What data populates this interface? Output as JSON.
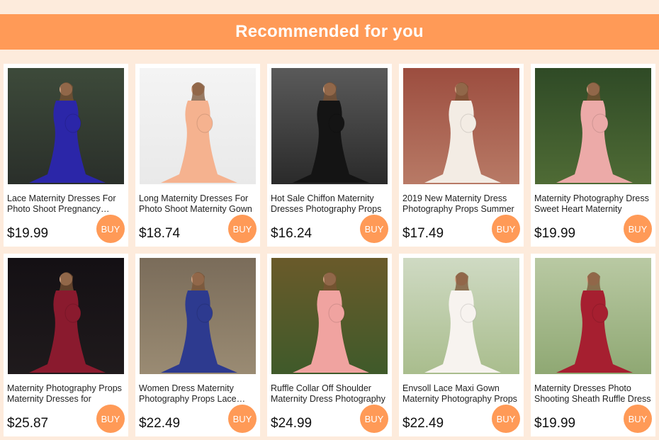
{
  "header": {
    "title": "Recommended for you"
  },
  "products": [
    {
      "title": "Lace Maternity Dresses For Photo Shoot Pregnancy Dress",
      "price": "$19.99",
      "buy_label": "BUY",
      "dress_color": "#2b26a8",
      "bg_top": "#3d4a3a",
      "bg_bottom": "#2a2f2a"
    },
    {
      "title": "Long Maternity Dresses For Photo Shoot Maternity Gown",
      "price": "$18.74",
      "buy_label": "BUY",
      "dress_color": "#f5b28f",
      "bg_top": "#f4f4f4",
      "bg_bottom": "#e9e9e9"
    },
    {
      "title": "Hot Sale Chiffon Maternity Dresses Photography Props",
      "price": "$16.24",
      "buy_label": "BUY",
      "dress_color": "#141414",
      "bg_top": "#5a5a5a",
      "bg_bottom": "#2a2a2a"
    },
    {
      "title": "2019 New Maternity Dress Photography Props Summer",
      "price": "$17.49",
      "buy_label": "BUY",
      "dress_color": "#f3ece4",
      "bg_top": "#9c4d3f",
      "bg_bottom": "#b87a66"
    },
    {
      "title": "Maternity Photography Dress Sweet Heart Maternity",
      "price": "$19.99",
      "buy_label": "BUY",
      "dress_color": "#ecaaa8",
      "bg_top": "#2f4a26",
      "bg_bottom": "#4f6b35"
    },
    {
      "title": "Maternity Photography Props Maternity Dresses for",
      "price": "$25.87",
      "buy_label": "BUY",
      "dress_color": "#8a1a2e",
      "bg_top": "#141014",
      "bg_bottom": "#1f1a1c"
    },
    {
      "title": "Women Dress Maternity Photography Props Lace Gown",
      "price": "$22.49",
      "buy_label": "BUY",
      "dress_color": "#2d3a8f",
      "bg_top": "#7a6c5a",
      "bg_bottom": "#9a8b73"
    },
    {
      "title": "Ruffle Collar Off Shoulder Maternity Dress Photography",
      "price": "$24.99",
      "buy_label": "BUY",
      "dress_color": "#f0a3a0",
      "bg_top": "#6a5a2a",
      "bg_bottom": "#3f5a2a"
    },
    {
      "title": "Envsoll Lace Maxi Gown Maternity Photography Props",
      "price": "$22.49",
      "buy_label": "BUY",
      "dress_color": "#f7f3ef",
      "bg_top": "#cfdac3",
      "bg_bottom": "#a9bd8d"
    },
    {
      "title": "Maternity Dresses Photo Shooting Sheath Ruffle Dress",
      "price": "$19.99",
      "buy_label": "BUY",
      "dress_color": "#a61f30",
      "bg_top": "#b9c9a3",
      "bg_bottom": "#8fa873"
    }
  ]
}
